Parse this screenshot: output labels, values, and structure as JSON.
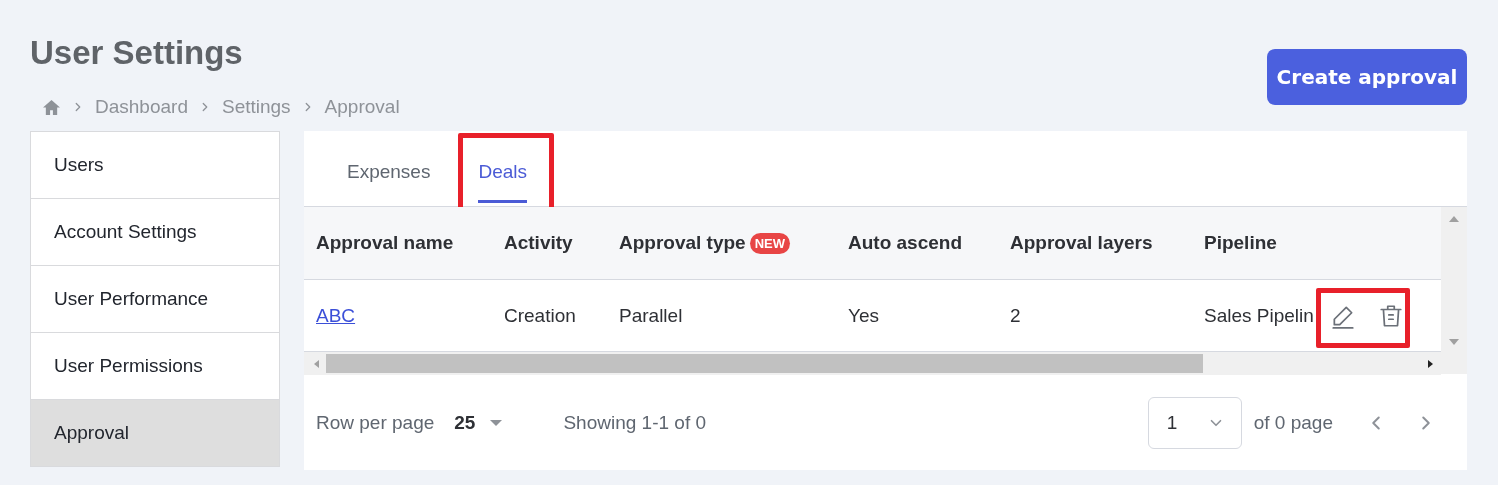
{
  "page_title": "User Settings",
  "breadcrumb": [
    "Dashboard",
    "Settings",
    "Approval"
  ],
  "create_button": "Create approval",
  "sidebar": {
    "items": [
      {
        "label": "Users",
        "selected": false
      },
      {
        "label": "Account Settings",
        "selected": false
      },
      {
        "label": "User Performance",
        "selected": false
      },
      {
        "label": "User Permissions",
        "selected": false
      },
      {
        "label": "Approval",
        "selected": true
      }
    ]
  },
  "tabs": [
    {
      "label": "Expenses",
      "selected": false,
      "highlighted": false
    },
    {
      "label": "Deals",
      "selected": true,
      "highlighted": true
    }
  ],
  "table": {
    "columns": [
      {
        "label": "Approval name"
      },
      {
        "label": "Activity"
      },
      {
        "label": "Approval type",
        "badge": "NEW"
      },
      {
        "label": "Auto ascend"
      },
      {
        "label": "Approval layers"
      },
      {
        "label": "Pipeline"
      }
    ],
    "rows": [
      {
        "cells": [
          "ABC",
          "Creation",
          "Parallel",
          "Yes",
          "2",
          "Sales Pipelin"
        ],
        "actions_highlighted": true
      }
    ]
  },
  "footer": {
    "rows_label": "Row per page",
    "rows_value": "25",
    "showing": "Showing 1-1 of 0",
    "page_value": "1",
    "page_total": "of 0 page"
  }
}
